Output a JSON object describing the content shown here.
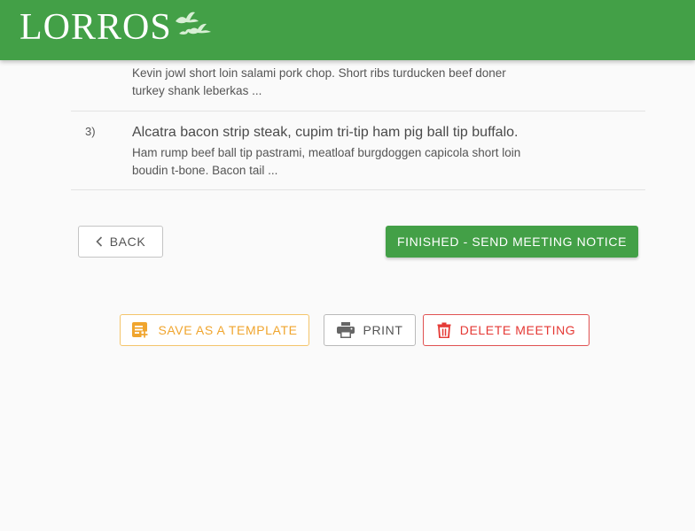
{
  "header": {
    "logo_text": "LORROS",
    "brand_color": "#43a047"
  },
  "items": [
    {
      "number": "",
      "title": "",
      "description": "Kevin jowl short loin salami pork chop. Short ribs turducken beef doner turkey shank leberkas ..."
    },
    {
      "number": "3)",
      "title": "Alcatra bacon strip steak, cupim tri-tip ham pig ball tip buffalo.",
      "description": "Ham rump beef ball tip pastrami, meatloaf burgdoggen capicola short loin boudin t-bone. Bacon tail ..."
    }
  ],
  "nav": {
    "back_label": "BACK",
    "back_icon": "chevron-left-icon",
    "finish_label": "FINISHED - SEND MEETING NOTICE"
  },
  "actions": {
    "template_label": "SAVE AS A TEMPLATE",
    "template_icon": "playlist-add-icon",
    "template_color": "#f0a52e",
    "print_label": "PRINT",
    "print_icon": "printer-icon",
    "delete_label": "DELETE MEETING",
    "delete_icon": "trash-icon",
    "delete_color": "#e53935"
  }
}
